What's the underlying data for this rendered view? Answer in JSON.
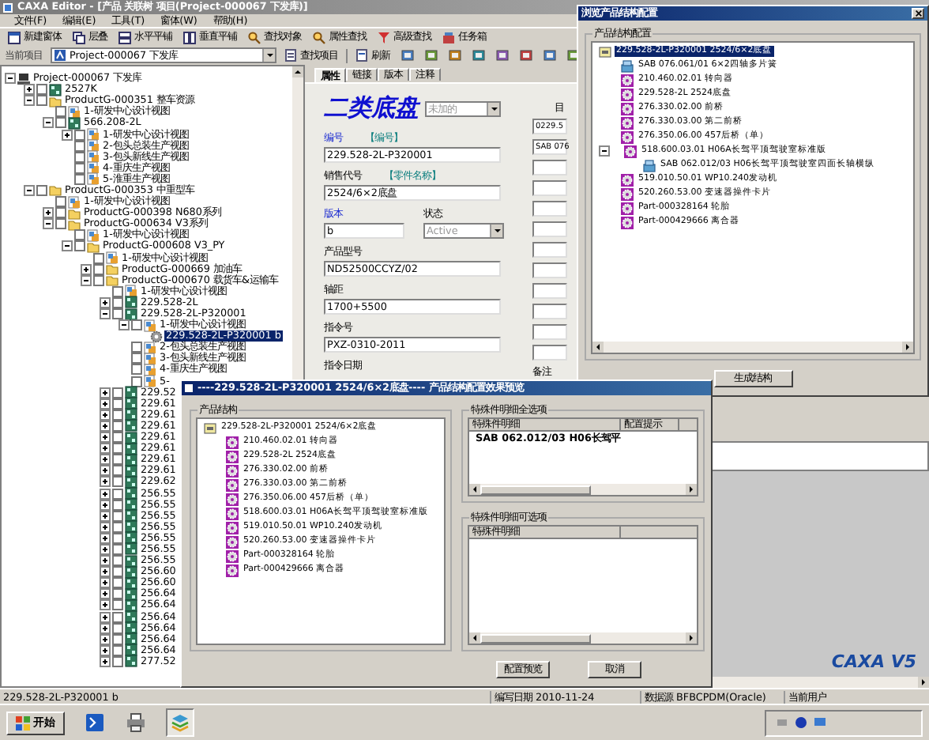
{
  "window": {
    "title": "CAXA Editor - [产品 关联树 项目(Project-000067   下发库)]"
  },
  "menu": [
    "文件(F)",
    "编辑(E)",
    "工具(T)",
    "窗体(W)",
    "帮助(H)"
  ],
  "toolbar": [
    {
      "label": "新建窗体",
      "kind": "window"
    },
    {
      "label": "层叠",
      "kind": "cascade"
    },
    {
      "label": "水平平铺",
      "kind": "htile"
    },
    {
      "label": "垂直平铺",
      "kind": "vtile"
    },
    {
      "label": "查找对象",
      "kind": "find"
    },
    {
      "label": "属性查找",
      "kind": "find"
    },
    {
      "label": "高级查找",
      "kind": "filter"
    },
    {
      "label": "任务箱",
      "kind": "box"
    }
  ],
  "project_bar": {
    "label": "当前项目",
    "value": "Project-000067   下发库",
    "find_button": "查找项目",
    "refresh_button": "刷新"
  },
  "tree": {
    "items": [
      {
        "label": "Project-000067   下发库",
        "kind": "project",
        "expanded": true,
        "selected": false,
        "children": [
          {
            "label": "2527K",
            "kind": "product",
            "expanded": false,
            "checked": false,
            "selected": false
          },
          {
            "label": "ProductG-000351   整车资源",
            "kind": "group",
            "expanded": true,
            "checked": false,
            "selected": false,
            "children": [
              {
                "label": "1-研发中心设计视图",
                "kind": "view",
                "checked": false,
                "selected": false
              },
              {
                "label": "566.208-2L",
                "kind": "product",
                "expanded": true,
                "checked": false,
                "selected": false,
                "children": [
                  {
                    "label": "1-研发中心设计视图",
                    "kind": "view",
                    "expanded": false,
                    "checked": false,
                    "selected": false
                  },
                  {
                    "label": "2-包头总装生产视图",
                    "kind": "view",
                    "checked": false,
                    "selected": false
                  },
                  {
                    "label": "3-包头新线生产视图",
                    "kind": "view",
                    "checked": false,
                    "selected": false
                  },
                  {
                    "label": "4-重庆生产视图",
                    "kind": "view",
                    "checked": false,
                    "selected": false
                  },
                  {
                    "label": "5-淮重生产视图",
                    "kind": "view",
                    "checked": false,
                    "selected": false
                  }
                ]
              }
            ]
          },
          {
            "label": "ProductG-000353   中重型车",
            "kind": "group",
            "expanded": true,
            "checked": false,
            "selected": false,
            "children": [
              {
                "label": "1-研发中心设计视图",
                "kind": "view",
                "checked": false,
                "selected": false
              },
              {
                "label": "ProductG-000398   N680系列",
                "kind": "group",
                "expanded": false,
                "checked": false,
                "selected": false
              },
              {
                "label": "ProductG-000634   V3系列",
                "kind": "group",
                "expanded": true,
                "checked": false,
                "selected": false,
                "children": [
                  {
                    "label": "1-研发中心设计视图",
                    "kind": "view",
                    "checked": false,
                    "selected": false
                  },
                  {
                    "label": "ProductG-000608   V3_PY",
                    "kind": "group",
                    "expanded": true,
                    "checked": false,
                    "selected": false,
                    "children": [
                      {
                        "label": "1-研发中心设计视图",
                        "kind": "view",
                        "checked": false,
                        "selected": false
                      },
                      {
                        "label": "ProductG-000669   加油车",
                        "kind": "group",
                        "expanded": false,
                        "checked": false,
                        "selected": false
                      },
                      {
                        "label": "ProductG-000670   载货车&运输车",
                        "kind": "group",
                        "expanded": true,
                        "checked": false,
                        "selected": false,
                        "children": [
                          {
                            "label": "1-研发中心设计视图",
                            "kind": "view",
                            "checked": false,
                            "selected": false
                          },
                          {
                            "label": "229.528-2L",
                            "kind": "product",
                            "expanded": false,
                            "checked": false,
                            "selected": false
                          },
                          {
                            "label": "229.528-2L-P320001",
                            "kind": "product",
                            "expanded": true,
                            "checked": false,
                            "selected": false,
                            "children": [
                              {
                                "label": "1-研发中心设计视图",
                                "kind": "view",
                                "expanded": true,
                                "checked": false,
                                "selected": false,
                                "children": [
                                  {
                                    "label": "229.528-2L-P320001   b",
                                    "kind": "doc",
                                    "selected": true
                                  }
                                ]
                              },
                              {
                                "label": "2-包头总装生产视图",
                                "kind": "view",
                                "checked": false,
                                "selected": false
                              },
                              {
                                "label": "3-包头新线生产视图",
                                "kind": "view",
                                "checked": false,
                                "selected": false
                              },
                              {
                                "label": "4-重庆生产视图",
                                "kind": "view",
                                "checked": false,
                                "selected": false
                              },
                              {
                                "label": "5-",
                                "kind": "view",
                                "checked": false,
                                "selected": false
                              }
                            ]
                          },
                          {
                            "label": "229.52",
                            "kind": "product",
                            "expanded": false,
                            "checked": false,
                            "selected": false
                          },
                          {
                            "label": "229.61",
                            "kind": "product",
                            "expanded": false,
                            "checked": false,
                            "selected": false
                          },
                          {
                            "label": "229.61",
                            "kind": "product",
                            "expanded": false,
                            "checked": false,
                            "selected": false
                          },
                          {
                            "label": "229.61",
                            "kind": "product",
                            "expanded": false,
                            "checked": false,
                            "selected": false
                          },
                          {
                            "label": "229.61",
                            "kind": "product",
                            "expanded": false,
                            "checked": false,
                            "selected": false
                          },
                          {
                            "label": "229.61",
                            "kind": "product",
                            "expanded": false,
                            "checked": false,
                            "selected": false
                          },
                          {
                            "label": "229.61",
                            "kind": "product",
                            "expanded": false,
                            "checked": false,
                            "selected": false
                          },
                          {
                            "label": "229.61",
                            "kind": "product",
                            "expanded": false,
                            "checked": false,
                            "selected": false
                          },
                          {
                            "label": "229.62",
                            "kind": "product",
                            "expanded": false,
                            "checked": false,
                            "selected": false
                          },
                          {
                            "label": "256.55",
                            "kind": "product",
                            "expanded": false,
                            "checked": false,
                            "selected": false
                          },
                          {
                            "label": "256.55",
                            "kind": "product",
                            "expanded": false,
                            "checked": false,
                            "selected": false
                          },
                          {
                            "label": "256.55",
                            "kind": "product",
                            "expanded": false,
                            "checked": false,
                            "selected": false
                          },
                          {
                            "label": "256.55",
                            "kind": "product",
                            "expanded": false,
                            "checked": false,
                            "selected": false
                          },
                          {
                            "label": "256.55",
                            "kind": "product",
                            "expanded": false,
                            "checked": false,
                            "selected": false
                          },
                          {
                            "label": "256.55",
                            "kind": "product",
                            "expanded": false,
                            "checked": false,
                            "selected": false
                          },
                          {
                            "label": "256.55",
                            "kind": "product",
                            "expanded": false,
                            "checked": false,
                            "selected": false
                          },
                          {
                            "label": "256.60",
                            "kind": "product",
                            "expanded": false,
                            "checked": false,
                            "selected": false
                          },
                          {
                            "label": "256.60",
                            "kind": "product",
                            "expanded": false,
                            "checked": false,
                            "selected": false
                          },
                          {
                            "label": "256.64",
                            "kind": "product",
                            "expanded": false,
                            "checked": false,
                            "selected": false
                          },
                          {
                            "label": "256.64",
                            "kind": "product",
                            "expanded": false,
                            "checked": false,
                            "selected": false
                          },
                          {
                            "label": "256.64",
                            "kind": "product",
                            "expanded": false,
                            "checked": false,
                            "selected": false
                          },
                          {
                            "label": "256.64",
                            "kind": "product",
                            "expanded": false,
                            "checked": false,
                            "selected": false
                          },
                          {
                            "label": "256.64",
                            "kind": "product",
                            "expanded": false,
                            "checked": false,
                            "selected": false
                          },
                          {
                            "label": "256.64",
                            "kind": "product",
                            "expanded": false,
                            "checked": false,
                            "selected": false
                          },
                          {
                            "label": "277.52",
                            "kind": "product",
                            "expanded": false,
                            "checked": false,
                            "selected": false
                          }
                        ]
                      }
                    ]
                  }
                ]
              }
            ]
          }
        ]
      }
    ]
  },
  "properties": {
    "tabs": [
      {
        "label": "属性",
        "selected": true
      },
      {
        "label": "链接",
        "selected": false
      },
      {
        "label": "版本",
        "selected": false
      },
      {
        "label": "注释",
        "selected": false
      }
    ],
    "title": "二类底盘",
    "template": "未加的",
    "fields": [
      {
        "kind": "text",
        "label": "编号",
        "required": true,
        "hint": "【编号】",
        "value": "229.528-2L-P320001"
      },
      {
        "kind": "text",
        "label": "销售代号",
        "required": false,
        "hint": "【零件名称】",
        "value": "2524/6×2底盘"
      },
      {
        "kind": "pair",
        "left": {
          "label": "版本",
          "required": true,
          "value": "b"
        },
        "right": {
          "label": "状态",
          "value": "Active",
          "disabled": true
        }
      },
      {
        "kind": "text",
        "label": "产品型号",
        "required": false,
        "value": "ND52500CCYZ/02"
      },
      {
        "kind": "text",
        "label": "轴距",
        "required": false,
        "value": "1700+5500"
      },
      {
        "kind": "text",
        "label": "指令号",
        "required": false,
        "value": "PXZ-0310-2011"
      },
      {
        "kind": "text",
        "label": "指令日期",
        "required": false
      }
    ],
    "side": {
      "label": "目",
      "values": [
        "0229.5",
        "SAB 076"
      ],
      "footer": "备注"
    }
  },
  "logo": "CAXA V5",
  "status_bar": [
    "229.528-2L-P320001   b",
    "编写日期 2010-11-24",
    "数据源 BFBCPDM(Oracle)",
    "当前用户"
  ],
  "taskbar": {
    "start": "开始"
  },
  "browse_dialog": {
    "title": "浏览产品结构配置",
    "group": "产品结构配置",
    "button": "生成结构",
    "tree": [
      {
        "label": "229.528-2L-P320001   2524/6×2底盘",
        "kind": "assembly",
        "selected": true,
        "children": [
          {
            "label": "SAB 076.061/01   6×2四轴多片簧",
            "kind": "special",
            "selected": false
          },
          {
            "label": "210.460.02.01   转向器",
            "kind": "part",
            "selected": false
          },
          {
            "label": "229.528-2L   2524底盘",
            "kind": "part",
            "selected": false
          },
          {
            "label": "276.330.02.00   前桥",
            "kind": "part",
            "selected": false
          },
          {
            "label": "276.330.03.00   第二前桥",
            "kind": "part",
            "selected": false
          },
          {
            "label": "276.350.06.00   457后桥（单）",
            "kind": "part",
            "selected": false
          },
          {
            "label": "518.600.03.01   H06A长驾平顶驾驶室标准版",
            "kind": "part",
            "expanded": true,
            "selected": false,
            "children": [
              {
                "label": "SAB 062.012/03   H06长驾平顶驾驶室四面长轴横纵",
                "kind": "special",
                "selected": false
              }
            ]
          },
          {
            "label": "519.010.50.01   WP10.240发动机",
            "kind": "part",
            "selected": false
          },
          {
            "label": "520.260.53.00   变速器操件卡片",
            "kind": "part",
            "selected": false
          },
          {
            "label": "Part-000328164   轮胎",
            "kind": "part",
            "selected": false
          },
          {
            "label": "Part-000429666   离合器",
            "kind": "part",
            "selected": false
          }
        ]
      }
    ]
  },
  "preview_dialog": {
    "title": "----229.528-2L-P320001   2524/6×2底盘---- 产品结构配置效果预览",
    "structure_group": "产品结构",
    "tree": [
      {
        "label": "229.528-2L-P320001   2524/6×2底盘",
        "kind": "assembly",
        "selected": false,
        "children": [
          {
            "label": "210.460.02.01   转向器",
            "kind": "part",
            "selected": false
          },
          {
            "label": "229.528-2L   2524底盘",
            "kind": "part",
            "selected": false
          },
          {
            "label": "276.330.02.00   前桥",
            "kind": "part",
            "selected": false
          },
          {
            "label": "276.330.03.00   第二前桥",
            "kind": "part",
            "selected": false
          },
          {
            "label": "276.350.06.00   457后桥（单）",
            "kind": "part",
            "selected": false
          },
          {
            "label": "518.600.03.01   H06A长驾平顶驾驶室标准版",
            "kind": "part",
            "selected": false
          },
          {
            "label": "519.010.50.01   WP10.240发动机",
            "kind": "part",
            "selected": false
          },
          {
            "label": "520.260.53.00   变速器操件卡片",
            "kind": "part",
            "selected": false
          },
          {
            "label": "Part-000328164   轮胎",
            "kind": "part",
            "selected": false
          },
          {
            "label": "Part-000429666   离合器",
            "kind": "part",
            "selected": false
          }
        ]
      }
    ],
    "required_group": {
      "title": "特殊件明细全选项",
      "columns": [
        "特殊件明细",
        "配置提示"
      ],
      "rows": [
        "SAB 062.012/03 H06长驾平"
      ]
    },
    "optional_group": {
      "title": "特殊件明细可选项",
      "columns": [
        "特殊件明细"
      ]
    },
    "buttons": [
      "配置预览",
      "取消"
    ]
  }
}
